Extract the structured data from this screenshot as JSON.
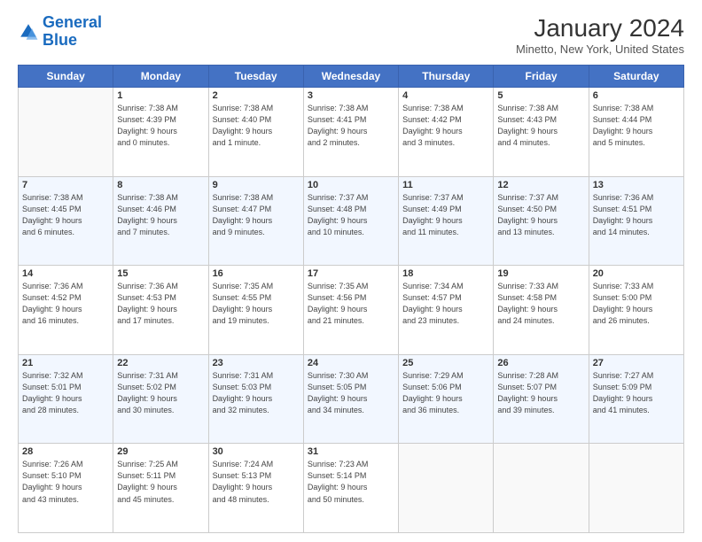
{
  "logo": {
    "line1": "General",
    "line2": "Blue"
  },
  "header": {
    "title": "January 2024",
    "subtitle": "Minetto, New York, United States"
  },
  "days_of_week": [
    "Sunday",
    "Monday",
    "Tuesday",
    "Wednesday",
    "Thursday",
    "Friday",
    "Saturday"
  ],
  "weeks": [
    [
      {
        "day": "",
        "info": ""
      },
      {
        "day": "1",
        "info": "Sunrise: 7:38 AM\nSunset: 4:39 PM\nDaylight: 9 hours\nand 0 minutes."
      },
      {
        "day": "2",
        "info": "Sunrise: 7:38 AM\nSunset: 4:40 PM\nDaylight: 9 hours\nand 1 minute."
      },
      {
        "day": "3",
        "info": "Sunrise: 7:38 AM\nSunset: 4:41 PM\nDaylight: 9 hours\nand 2 minutes."
      },
      {
        "day": "4",
        "info": "Sunrise: 7:38 AM\nSunset: 4:42 PM\nDaylight: 9 hours\nand 3 minutes."
      },
      {
        "day": "5",
        "info": "Sunrise: 7:38 AM\nSunset: 4:43 PM\nDaylight: 9 hours\nand 4 minutes."
      },
      {
        "day": "6",
        "info": "Sunrise: 7:38 AM\nSunset: 4:44 PM\nDaylight: 9 hours\nand 5 minutes."
      }
    ],
    [
      {
        "day": "7",
        "info": "Sunrise: 7:38 AM\nSunset: 4:45 PM\nDaylight: 9 hours\nand 6 minutes."
      },
      {
        "day": "8",
        "info": "Sunrise: 7:38 AM\nSunset: 4:46 PM\nDaylight: 9 hours\nand 7 minutes."
      },
      {
        "day": "9",
        "info": "Sunrise: 7:38 AM\nSunset: 4:47 PM\nDaylight: 9 hours\nand 9 minutes."
      },
      {
        "day": "10",
        "info": "Sunrise: 7:37 AM\nSunset: 4:48 PM\nDaylight: 9 hours\nand 10 minutes."
      },
      {
        "day": "11",
        "info": "Sunrise: 7:37 AM\nSunset: 4:49 PM\nDaylight: 9 hours\nand 11 minutes."
      },
      {
        "day": "12",
        "info": "Sunrise: 7:37 AM\nSunset: 4:50 PM\nDaylight: 9 hours\nand 13 minutes."
      },
      {
        "day": "13",
        "info": "Sunrise: 7:36 AM\nSunset: 4:51 PM\nDaylight: 9 hours\nand 14 minutes."
      }
    ],
    [
      {
        "day": "14",
        "info": "Sunrise: 7:36 AM\nSunset: 4:52 PM\nDaylight: 9 hours\nand 16 minutes."
      },
      {
        "day": "15",
        "info": "Sunrise: 7:36 AM\nSunset: 4:53 PM\nDaylight: 9 hours\nand 17 minutes."
      },
      {
        "day": "16",
        "info": "Sunrise: 7:35 AM\nSunset: 4:55 PM\nDaylight: 9 hours\nand 19 minutes."
      },
      {
        "day": "17",
        "info": "Sunrise: 7:35 AM\nSunset: 4:56 PM\nDaylight: 9 hours\nand 21 minutes."
      },
      {
        "day": "18",
        "info": "Sunrise: 7:34 AM\nSunset: 4:57 PM\nDaylight: 9 hours\nand 23 minutes."
      },
      {
        "day": "19",
        "info": "Sunrise: 7:33 AM\nSunset: 4:58 PM\nDaylight: 9 hours\nand 24 minutes."
      },
      {
        "day": "20",
        "info": "Sunrise: 7:33 AM\nSunset: 5:00 PM\nDaylight: 9 hours\nand 26 minutes."
      }
    ],
    [
      {
        "day": "21",
        "info": "Sunrise: 7:32 AM\nSunset: 5:01 PM\nDaylight: 9 hours\nand 28 minutes."
      },
      {
        "day": "22",
        "info": "Sunrise: 7:31 AM\nSunset: 5:02 PM\nDaylight: 9 hours\nand 30 minutes."
      },
      {
        "day": "23",
        "info": "Sunrise: 7:31 AM\nSunset: 5:03 PM\nDaylight: 9 hours\nand 32 minutes."
      },
      {
        "day": "24",
        "info": "Sunrise: 7:30 AM\nSunset: 5:05 PM\nDaylight: 9 hours\nand 34 minutes."
      },
      {
        "day": "25",
        "info": "Sunrise: 7:29 AM\nSunset: 5:06 PM\nDaylight: 9 hours\nand 36 minutes."
      },
      {
        "day": "26",
        "info": "Sunrise: 7:28 AM\nSunset: 5:07 PM\nDaylight: 9 hours\nand 39 minutes."
      },
      {
        "day": "27",
        "info": "Sunrise: 7:27 AM\nSunset: 5:09 PM\nDaylight: 9 hours\nand 41 minutes."
      }
    ],
    [
      {
        "day": "28",
        "info": "Sunrise: 7:26 AM\nSunset: 5:10 PM\nDaylight: 9 hours\nand 43 minutes."
      },
      {
        "day": "29",
        "info": "Sunrise: 7:25 AM\nSunset: 5:11 PM\nDaylight: 9 hours\nand 45 minutes."
      },
      {
        "day": "30",
        "info": "Sunrise: 7:24 AM\nSunset: 5:13 PM\nDaylight: 9 hours\nand 48 minutes."
      },
      {
        "day": "31",
        "info": "Sunrise: 7:23 AM\nSunset: 5:14 PM\nDaylight: 9 hours\nand 50 minutes."
      },
      {
        "day": "",
        "info": ""
      },
      {
        "day": "",
        "info": ""
      },
      {
        "day": "",
        "info": ""
      }
    ]
  ]
}
